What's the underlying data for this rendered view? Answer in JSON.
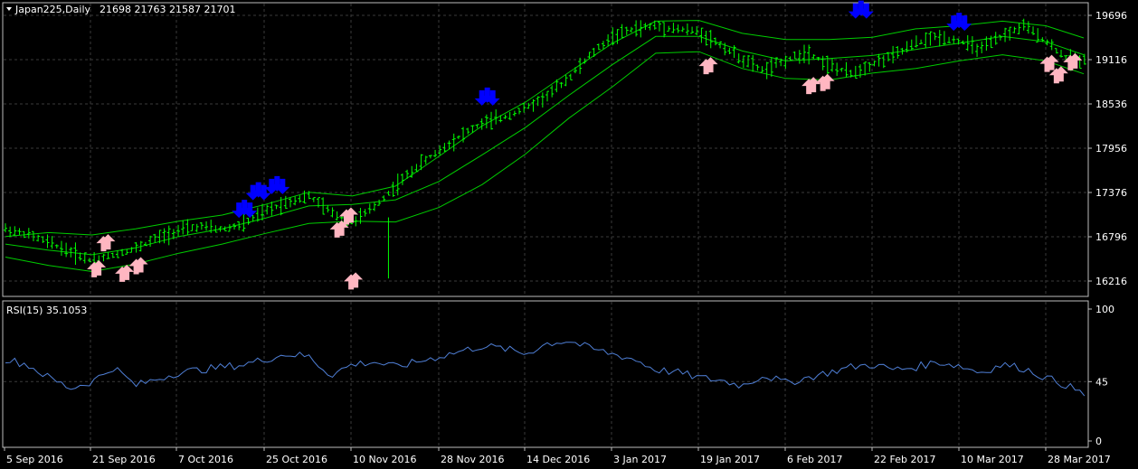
{
  "header": {
    "symbol": "Japan225,Daily",
    "ohlc": "21698 21763 21587 21701"
  },
  "rsi_header": {
    "label": "RSI(15) 35.1053"
  },
  "colors": {
    "background": "#000000",
    "grid": "#3a3a3a",
    "candle": "#00ff00",
    "band": "#00cc00",
    "rsi_line": "#4f7fd6",
    "up_arrow": "#ffb6c1",
    "down_arrow": "#0000ff",
    "text": "#ffffff"
  },
  "chart_data": [
    {
      "type": "line",
      "title": "Japan225,Daily 21698 21763 21587 21701",
      "y_axis_ticks": [
        "19696",
        "19116",
        "18536",
        "17956",
        "17376",
        "16796",
        "16216"
      ],
      "ylim": [
        16100,
        19820
      ],
      "x_axis_ticks": [
        "5 Sep 2016",
        "21 Sep 2016",
        "7 Oct 2016",
        "25 Oct 2016",
        "10 Nov 2016",
        "28 Nov 2016",
        "14 Dec 2016",
        "3 Jan 2017",
        "19 Jan 2017",
        "6 Feb 2017",
        "22 Feb 2017",
        "10 Mar 2017",
        "28 Mar 2017"
      ],
      "grid": true,
      "series": [
        {
          "key": "close",
          "x": [
            0,
            4,
            8,
            12,
            16,
            20,
            24,
            28,
            32,
            36,
            40,
            44,
            48,
            52,
            56,
            60,
            64,
            68,
            72,
            76,
            80,
            84,
            88,
            92,
            96,
            100,
            104,
            108,
            112,
            116,
            120,
            124,
            128,
            132,
            136,
            140,
            144,
            148,
            152,
            156,
            160,
            164,
            168,
            172,
            176,
            180,
            184,
            188,
            192,
            196
          ],
          "values": [
            16900,
            16830,
            16720,
            16600,
            16480,
            16560,
            16640,
            16780,
            16880,
            16930,
            16890,
            16960,
            17130,
            17250,
            17330,
            17120,
            16980,
            17180,
            17460,
            17720,
            17920,
            18120,
            18280,
            18360,
            18480,
            18640,
            18880,
            19180,
            19420,
            19520,
            19560,
            19520,
            19480,
            19310,
            19120,
            18970,
            19110,
            19220,
            19040,
            18930,
            19060,
            19170,
            19330,
            19420,
            19360,
            19250,
            19420,
            19560,
            19360,
            19120
          ]
        },
        {
          "key": "upper_band",
          "x": [
            0,
            8,
            16,
            24,
            32,
            40,
            48,
            56,
            64,
            72,
            80,
            88,
            96,
            104,
            112,
            120,
            128,
            136,
            144,
            152,
            160,
            168,
            176,
            184,
            192,
            199
          ],
          "values": [
            16800,
            16850,
            16820,
            16900,
            17000,
            17080,
            17220,
            17380,
            17330,
            17460,
            17850,
            18250,
            18560,
            18950,
            19330,
            19620,
            19630,
            19460,
            19380,
            19380,
            19410,
            19520,
            19560,
            19620,
            19560,
            19400
          ]
        },
        {
          "key": "middle_band",
          "x": [
            0,
            8,
            16,
            24,
            32,
            40,
            48,
            56,
            64,
            72,
            80,
            88,
            96,
            104,
            112,
            120,
            128,
            136,
            144,
            152,
            160,
            168,
            176,
            184,
            192,
            199
          ],
          "values": [
            16700,
            16620,
            16560,
            16650,
            16800,
            16900,
            17040,
            17200,
            17220,
            17280,
            17520,
            17870,
            18230,
            18650,
            19050,
            19420,
            19420,
            19230,
            19100,
            19130,
            19170,
            19250,
            19330,
            19420,
            19350,
            19180
          ]
        },
        {
          "key": "lower_band",
          "x": [
            0,
            8,
            16,
            24,
            32,
            40,
            48,
            56,
            64,
            72,
            80,
            88,
            96,
            104,
            112,
            120,
            128,
            136,
            144,
            152,
            160,
            168,
            176,
            184,
            192,
            199
          ],
          "values": [
            16530,
            16420,
            16340,
            16440,
            16580,
            16700,
            16840,
            16970,
            17000,
            16990,
            17180,
            17480,
            17880,
            18350,
            18760,
            19200,
            19220,
            19000,
            18870,
            18850,
            18940,
            19000,
            19100,
            19180,
            19100,
            18930
          ]
        }
      ],
      "buy_signals": [
        {
          "x": 19,
          "y": 16360
        },
        {
          "x": 21,
          "y": 16700
        },
        {
          "x": 25,
          "y": 16300
        },
        {
          "x": 28,
          "y": 16400
        },
        {
          "x": 71,
          "y": 16880
        },
        {
          "x": 73,
          "y": 17050
        },
        {
          "x": 74,
          "y": 16200
        },
        {
          "x": 150,
          "y": 19020
        },
        {
          "x": 172,
          "y": 18760
        },
        {
          "x": 175,
          "y": 18800
        },
        {
          "x": 223,
          "y": 19050
        },
        {
          "x": 225,
          "y": 18900
        },
        {
          "x": 228,
          "y": 19070
        }
      ],
      "sell_signals": [
        {
          "x": 50,
          "y": 17150
        },
        {
          "x": 53,
          "y": 17380
        },
        {
          "x": 57,
          "y": 17460
        },
        {
          "x": 102,
          "y": 18620
        },
        {
          "x": 182,
          "y": 19760
        },
        {
          "x": 203,
          "y": 19600
        }
      ]
    },
    {
      "type": "line",
      "title": "RSI(15) 35.1053",
      "y_axis_ticks": [
        "100",
        "45",
        "0"
      ],
      "ylim": [
        0,
        100
      ],
      "series": [
        {
          "key": "rsi",
          "x": [
            0,
            4,
            8,
            12,
            16,
            20,
            24,
            28,
            32,
            36,
            40,
            44,
            48,
            52,
            56,
            60,
            64,
            68,
            72,
            76,
            80,
            84,
            88,
            92,
            96,
            100,
            104,
            108,
            112,
            116,
            120,
            124,
            128,
            132,
            136,
            140,
            144,
            148,
            152,
            156,
            160,
            164,
            168,
            172,
            176,
            180,
            184,
            188,
            192,
            196,
            199
          ],
          "values": [
            62,
            58,
            48,
            40,
            45,
            56,
            42,
            47,
            52,
            54,
            56,
            58,
            62,
            66,
            64,
            50,
            58,
            60,
            56,
            60,
            64,
            68,
            72,
            70,
            66,
            74,
            76,
            70,
            66,
            62,
            54,
            52,
            48,
            46,
            42,
            50,
            44,
            48,
            52,
            56,
            58,
            54,
            56,
            60,
            57,
            52,
            58,
            55,
            48,
            42,
            35
          ]
        }
      ]
    }
  ]
}
